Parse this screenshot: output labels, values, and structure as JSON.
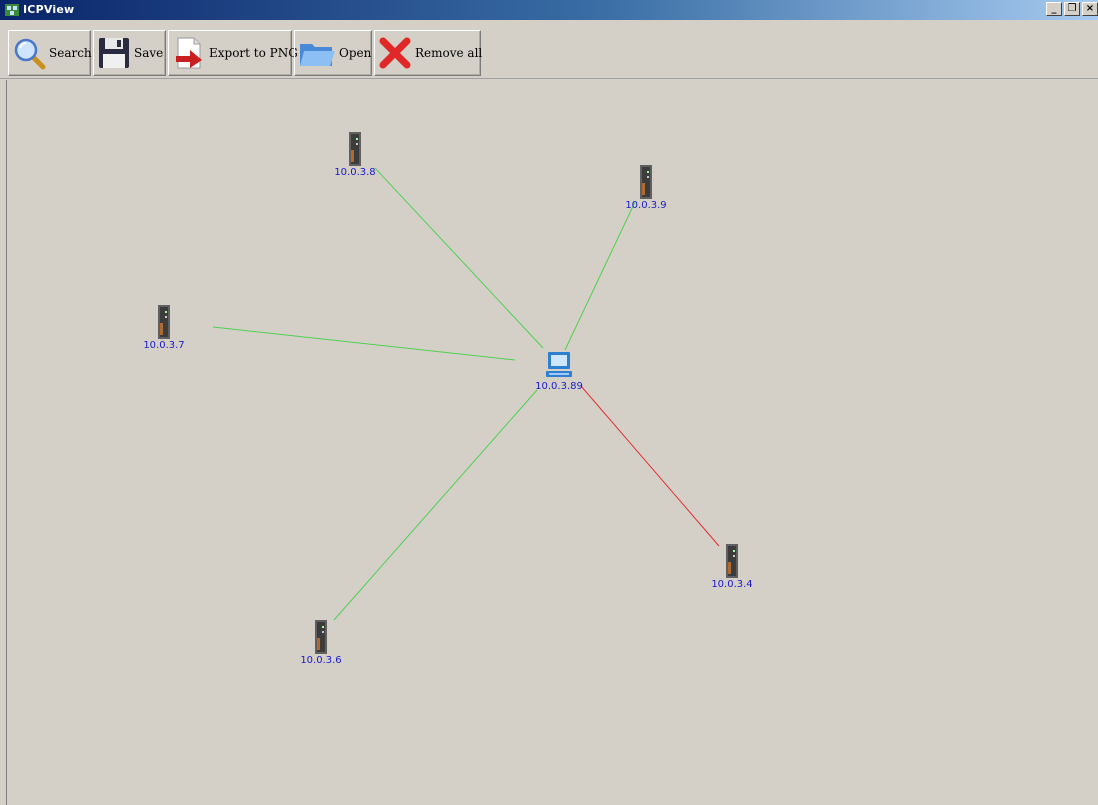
{
  "window": {
    "title": "ICPView",
    "controls": [
      "_",
      "8",
      "x"
    ]
  },
  "toolbar": {
    "search_label": "Search",
    "save_label": "Save",
    "export_label": "Export to PNG",
    "open_label": "Open",
    "remove_all_label": "Remove all"
  },
  "colors": {
    "ok_link": "#50d050",
    "bad_link": "#e03030",
    "node_label": "#1a1acc"
  },
  "network": {
    "hub": {
      "ip": "10.0.3.89",
      "icon": "computer-icon"
    },
    "devices": [
      {
        "ip": "10.0.3.8",
        "icon": "device-icon",
        "link_status": "ok"
      },
      {
        "ip": "10.0.3.9",
        "icon": "device-icon",
        "link_status": "ok"
      },
      {
        "ip": "10.0.3.7",
        "icon": "device-icon",
        "link_status": "ok"
      },
      {
        "ip": "10.0.3.6",
        "icon": "device-icon",
        "link_status": "ok"
      },
      {
        "ip": "10.0.3.4",
        "icon": "device-icon",
        "link_status": "error"
      }
    ]
  }
}
